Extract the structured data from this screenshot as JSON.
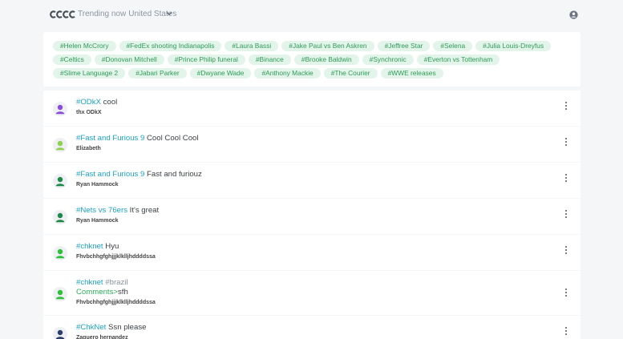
{
  "header": {
    "trending_label": "Trending now",
    "country": "United States",
    "logo_icon": "logo-icon",
    "chevron_icon": "chevron-down-icon",
    "user_icon": "user-circle-icon"
  },
  "tags": [
    "#Helen McCrory",
    "#FedEx shooting Indianapolis",
    "#Laura Bassi",
    "#Jake Paul vs Ben Askren",
    "#Jeffree Star",
    "#Selena",
    "#Julia Louis-Dreyfus",
    "#Celtics",
    "#Donovan Mitchell",
    "#Prince Philip funeral",
    "#Binance",
    "#Brooke Baldwin",
    "#Synchronic",
    "#Everton vs Tottenham",
    "#Slime Language 2",
    "#Jabari Parker",
    "#Dwyane Wade",
    "#Anthony Mackie",
    "#The Courier",
    "#WWE releases"
  ],
  "posts": [
    {
      "hashtag": "#ODkX",
      "text": "cool",
      "author": "thx ODkX",
      "avatar_color": "#8a4dd8"
    },
    {
      "hashtag": "#Fast and Furious 9",
      "text": "Cool Cool Cool",
      "author": "Elizabeth",
      "avatar_color": "#8fd14f"
    },
    {
      "hashtag": "#Fast and Furious 9",
      "text": "Fast and furiouz",
      "author": "Ryan Hammock",
      "avatar_color": "#1e8a4a"
    },
    {
      "hashtag": "#Nets vs 76ers",
      "text": "It's great",
      "author": "Ryan Hammock",
      "avatar_color": "#1e8a4a"
    },
    {
      "hashtag": "#chknet",
      "text": "Hyu",
      "author": "Fhvbchhgfghjjjklklljhddddssa",
      "avatar_color": "#2fbf3a"
    },
    {
      "hashtag": "#chknet",
      "hashtag2": "#brazil",
      "comment_label": "Comments>",
      "comment_text": "sfh",
      "author": "Fhvbchhgfghjjjklklljhddddssa",
      "avatar_color": "#2fbf3a"
    },
    {
      "hashtag": "#ChkNet",
      "text": "Ssn please",
      "author": "Zaquero hernandez",
      "avatar_color": "#2c3e6b"
    }
  ],
  "colors": {
    "hashtag": "#1ba3c4",
    "tag_bg": "#e3f5ea",
    "tag_text": "#2f9a57",
    "comment": "#2fae5a"
  }
}
